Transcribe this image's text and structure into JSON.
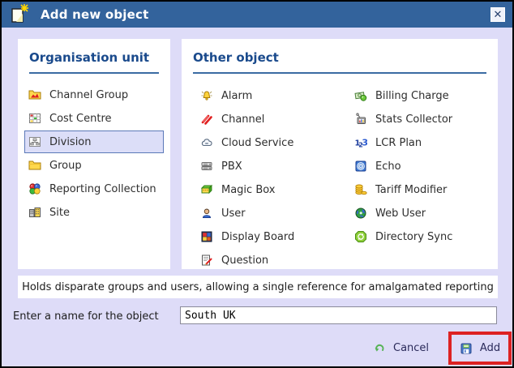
{
  "window": {
    "title": "Add new object",
    "title_icon": "new-document-sparkle",
    "close_glyph": "✕"
  },
  "left_panel": {
    "title": "Organisation unit",
    "items": [
      {
        "label": "Channel Group",
        "icon": "channel-group-folder-chart-icon",
        "selected": false
      },
      {
        "label": "Cost Centre",
        "icon": "cost-centre-grid-icon",
        "selected": false
      },
      {
        "label": "Division",
        "icon": "division-org-chart-icon",
        "selected": true
      },
      {
        "label": "Group",
        "icon": "group-folder-icon",
        "selected": false
      },
      {
        "label": "Reporting Collection",
        "icon": "reporting-collection-balls-icon",
        "selected": false
      },
      {
        "label": "Site",
        "icon": "site-buildings-icon",
        "selected": false
      }
    ]
  },
  "right_panel": {
    "title": "Other object",
    "column1": [
      {
        "label": "Alarm",
        "icon": "alarm-bell-icon"
      },
      {
        "label": "Channel",
        "icon": "channel-pipes-icon"
      },
      {
        "label": "Cloud Service",
        "icon": "cloud-icon"
      },
      {
        "label": "PBX",
        "icon": "pbx-server-icon"
      },
      {
        "label": "Magic Box",
        "icon": "magic-box-icon"
      },
      {
        "label": "User",
        "icon": "user-person-icon"
      },
      {
        "label": "Display Board",
        "icon": "display-board-grid-icon"
      },
      {
        "label": "Question",
        "icon": "question-doc-pencil-icon"
      }
    ],
    "column2": [
      {
        "label": "Billing Charge",
        "icon": "billing-money-icon"
      },
      {
        "label": "Stats Collector",
        "icon": "stats-collector-tv-icon"
      },
      {
        "label": "LCR Plan",
        "icon": "lcr-123-icon"
      },
      {
        "label": "Echo",
        "icon": "echo-rings-icon"
      },
      {
        "label": "Tariff Modifier",
        "icon": "tariff-coins-icon"
      },
      {
        "label": "Web User",
        "icon": "web-globe-user-icon"
      },
      {
        "label": "Directory Sync",
        "icon": "directory-sync-arrows-icon"
      }
    ]
  },
  "description": "Holds disparate groups and users, allowing a single reference for amalgamated reporting",
  "name_field": {
    "label": "Enter a name for the object",
    "value": "South UK"
  },
  "actions": {
    "cancel_label": "Cancel",
    "add_label": "Add"
  },
  "annotation": {
    "highlighted_control": "add-button",
    "color": "#dd2222"
  },
  "colors": {
    "titlebar": "#33639c",
    "dialog_background": "#dedcf8",
    "panel_background": "#ffffff",
    "heading_text": "#1a4a8c",
    "selected_item_border": "#5b79b8",
    "selected_item_fill": "#dcdef8",
    "annotation_red": "#dd2222"
  }
}
